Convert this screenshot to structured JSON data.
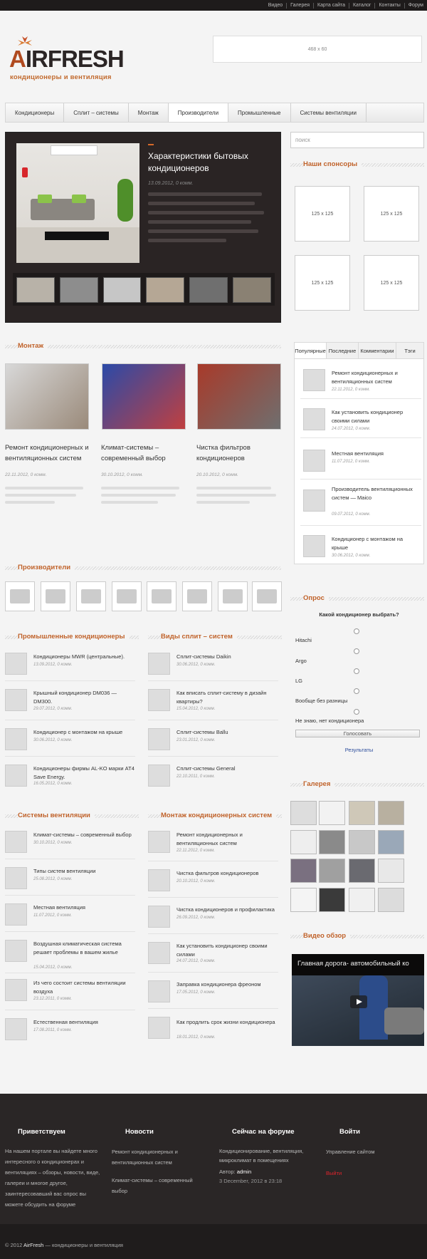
{
  "topnav": [
    "Видео",
    "Галерея",
    "Карта сайта",
    "Каталог",
    "Контакты",
    "Форум"
  ],
  "logo": {
    "prefix": "A",
    "word": "IRFRESH",
    "tagline": "кондиционеры и вентиляция"
  },
  "banner_top": "468 x 60",
  "mainnav": [
    {
      "label": "Кондиционеры",
      "active": false
    },
    {
      "label": "Сплит – системы",
      "active": false
    },
    {
      "label": "Монтаж",
      "active": false
    },
    {
      "label": "Производители",
      "active": true
    },
    {
      "label": "Промышленные",
      "active": false
    },
    {
      "label": "Системы вентиляции",
      "active": false
    }
  ],
  "search_placeholder": "поиск",
  "featured": {
    "title": "Характеристики бытовых кондиционеров",
    "meta": "13.09.2012, 0 комм."
  },
  "sponsors": {
    "title": "Наши спонсоры",
    "items": [
      "125 x 125",
      "125 x 125",
      "125 x 125",
      "125 x 125"
    ]
  },
  "montazh": {
    "title": "Монтаж",
    "items": [
      {
        "title": "Ремонт кондиционерных и вентиляционных систем",
        "meta": "22.11.2012, 0 комм."
      },
      {
        "title": "Климат-системы – современный выбор",
        "meta": "30.10.2012, 0 комм."
      },
      {
        "title": "Чистка фильтров кондиционеров",
        "meta": "20.10.2012, 0 комм."
      }
    ]
  },
  "tabs": {
    "labels": [
      "Популярные",
      "Последние",
      "Комментарии",
      "Тэги"
    ],
    "items": [
      {
        "title": "Ремонт кондиционерных и вентиляционных систем",
        "meta": "22.11.2012, 0 комм."
      },
      {
        "title": "Как установить кондиционер своими силами",
        "meta": "24.07.2012, 0 комм."
      },
      {
        "title": "Местная вентиляция",
        "meta": "11.07.2012, 0 комм."
      },
      {
        "title": "Производитель вентиляционных систем — Maico",
        "meta": "09.07.2012, 0 комм."
      },
      {
        "title": "Кондиционер с монтажом на крыше",
        "meta": "30.06.2012, 0 комм."
      }
    ]
  },
  "producers": {
    "title": "Производители"
  },
  "poll": {
    "title": "Опрос",
    "question": "Какой кондиционер выбрать?",
    "options": [
      "Hitachi",
      "Argo",
      "LG",
      "Вообще без разницы",
      "Не знаю, нет кондиционера"
    ],
    "vote": "Голосовать",
    "results": "Результаты"
  },
  "industrial": {
    "title": "Промышленные кондиционеры",
    "items": [
      {
        "title": "Кондиционеры MWR (центральные).",
        "meta": "13.09.2012, 0 комм."
      },
      {
        "title": "Крышный кондиционер DM036 — DM300.",
        "meta": "29.07.2012, 0 комм."
      },
      {
        "title": "Кондиционер с монтажом на крыше",
        "meta": "30.06.2012, 0 комм."
      },
      {
        "title": "Кондиционеры фирмы AL-KO марки AT4 Save Energy.",
        "meta": "16.05.2012, 0 комм."
      }
    ]
  },
  "split": {
    "title": "Виды сплит – систем",
    "items": [
      {
        "title": "Сплит-системы Daikin",
        "meta": "30.06.2012, 0 комм."
      },
      {
        "title": "Как вписать сплит-систему в дизайн квартиры?",
        "meta": "15.04.2012, 0 комм."
      },
      {
        "title": "Сплит-системы Ballu",
        "meta": "23.01.2012, 0 комм."
      },
      {
        "title": "Сплит-системы General",
        "meta": "22.10.2011, 0 комм."
      }
    ]
  },
  "gallery": {
    "title": "Галерея"
  },
  "vent": {
    "title": "Системы вентиляции",
    "items": [
      {
        "title": "Климат-системы – современный выбор",
        "meta": "30.10.2012, 0 комм."
      },
      {
        "title": "Типы систем вентиляции",
        "meta": "25.08.2012, 0 комм."
      },
      {
        "title": "Местная вентиляция",
        "meta": "11.07.2012, 0 комм."
      },
      {
        "title": "Воздушная климатическая система решает проблемы в вашем жилье",
        "meta": "15.04.2012, 0 комм."
      },
      {
        "title": "Из чего состоит системы вентиляции воздуха",
        "meta": "23.12.2011, 0 комм."
      },
      {
        "title": "Естественная вентиляция",
        "meta": "17.08.2011, 0 комм."
      }
    ]
  },
  "mount": {
    "title": "Монтаж кондиционерных систем",
    "items": [
      {
        "title": "Ремонт кондиционерных и вентиляционных систем",
        "meta": "22.11.2012, 0 комм."
      },
      {
        "title": "Чистка фильтров кондиционеров",
        "meta": "20.10.2012, 0 комм."
      },
      {
        "title": "Чистка кондиционеров и профилактика",
        "meta": "26.09.2012, 0 комм."
      },
      {
        "title": "Как установить кондиционер своими силами",
        "meta": "24.07.2012, 0 комм."
      },
      {
        "title": "Заправка кондиционера фреоном",
        "meta": "17.05.2012, 0 комм."
      },
      {
        "title": "Как продлить срок жизни кондиционера",
        "meta": "18.01.2012, 0 комм."
      }
    ]
  },
  "video": {
    "title": "Видео обзор",
    "caption": "Главная дорога- автомобильный ко"
  },
  "footer": {
    "welcome": {
      "title": "Приветствуем",
      "text": "На нашем портале вы найдете много интересного о кондиционерах и вентиляциях – обзоры, новости, виде, галереи и многое другое, заинтересовавший вас опрос вы можете обсудить на форуме"
    },
    "news": {
      "title": "Новости",
      "items": [
        "Ремонт кондиционерных и вентиляционных систем",
        "Климат-системы – современный выбор"
      ]
    },
    "forum": {
      "title": "Сейчас на форуме",
      "topic": "Кондиционирование, вентиляция, микроклимат в помещениях",
      "author_label": "Автор:",
      "author": "admin",
      "date": "3 December, 2012 в 23:18"
    },
    "login": {
      "title": "Войти",
      "manage": "Управление сайтом",
      "logout": "Выйти"
    }
  },
  "copyright": {
    "year": "© 2012",
    "name": "AirFresh",
    "rest": "— кондиционеры и вентиляция"
  },
  "colors": {
    "accent": "#c0622a",
    "dark": "#2a2626"
  }
}
